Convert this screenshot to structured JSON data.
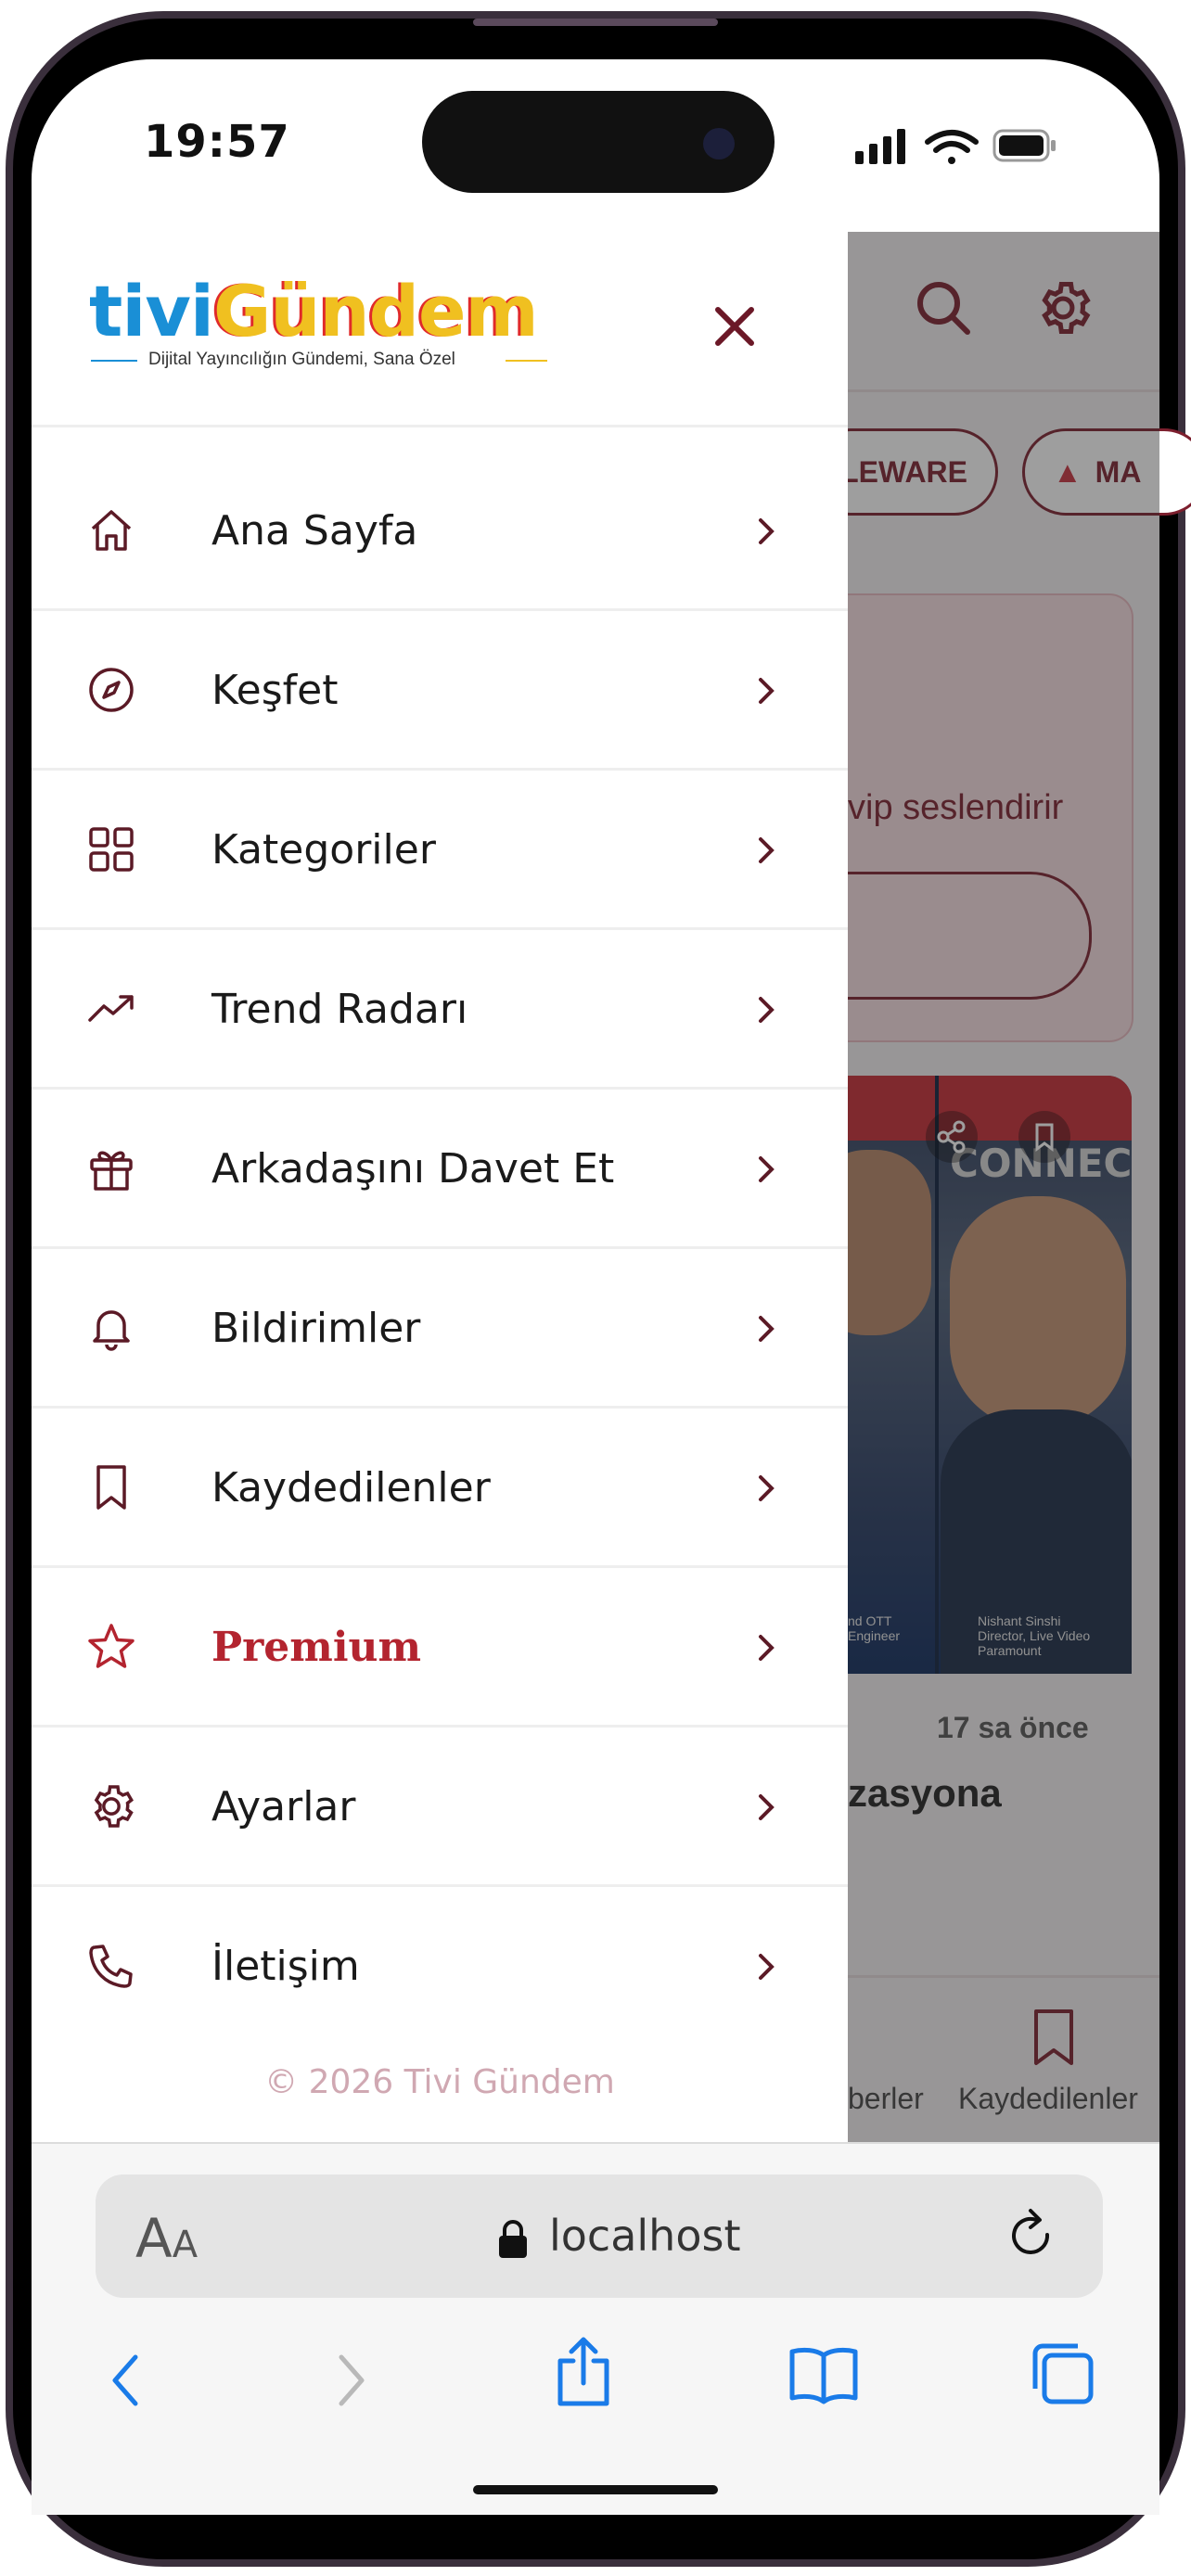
{
  "status_bar": {
    "time": "19:57"
  },
  "colors": {
    "brand": "#7d1f2e",
    "premium": "#b3242f",
    "safari_blue": "#1a7be8"
  },
  "background_page": {
    "pills": [
      "LEWARE",
      "MA"
    ],
    "card_text": "vip seslendirir",
    "news_time": "17 sa önce",
    "news_headline": "zasyona",
    "image_caption_left": "nd OTT Engineer",
    "image_caption_right": "Nishant Sinshi Director, Live Video Paramount",
    "image_overlay_text": "CONNECT",
    "tabs": [
      {
        "label": "berler",
        "icon": "newspaper-icon"
      },
      {
        "label": "Kaydedilenler",
        "icon": "bookmark-icon"
      }
    ]
  },
  "drawer": {
    "logo": {
      "part1": "tivi",
      "part2": "Gündem",
      "tagline": "Dijital Yayıncılığın Gündemi, Sana Özel"
    },
    "menu": [
      {
        "label": "Ana Sayfa",
        "icon": "home-icon"
      },
      {
        "label": "Keşfet",
        "icon": "compass-icon"
      },
      {
        "label": "Kategoriler",
        "icon": "grid-icon"
      },
      {
        "label": "Trend Radarı",
        "icon": "trending-icon"
      },
      {
        "label": "Arkadaşını Davet Et",
        "icon": "gift-icon"
      },
      {
        "label": "Bildirimler",
        "icon": "bell-icon"
      },
      {
        "label": "Kaydedilenler",
        "icon": "bookmark-icon"
      },
      {
        "label": "Premium",
        "icon": "star-icon"
      },
      {
        "label": "Ayarlar",
        "icon": "gear-icon"
      },
      {
        "label": "İletişim",
        "icon": "phone-icon"
      }
    ],
    "copyright": "© 2026 Tivi Gündem"
  },
  "safari": {
    "text_size_label_big": "A",
    "text_size_label_small": "A",
    "url": "localhost"
  }
}
